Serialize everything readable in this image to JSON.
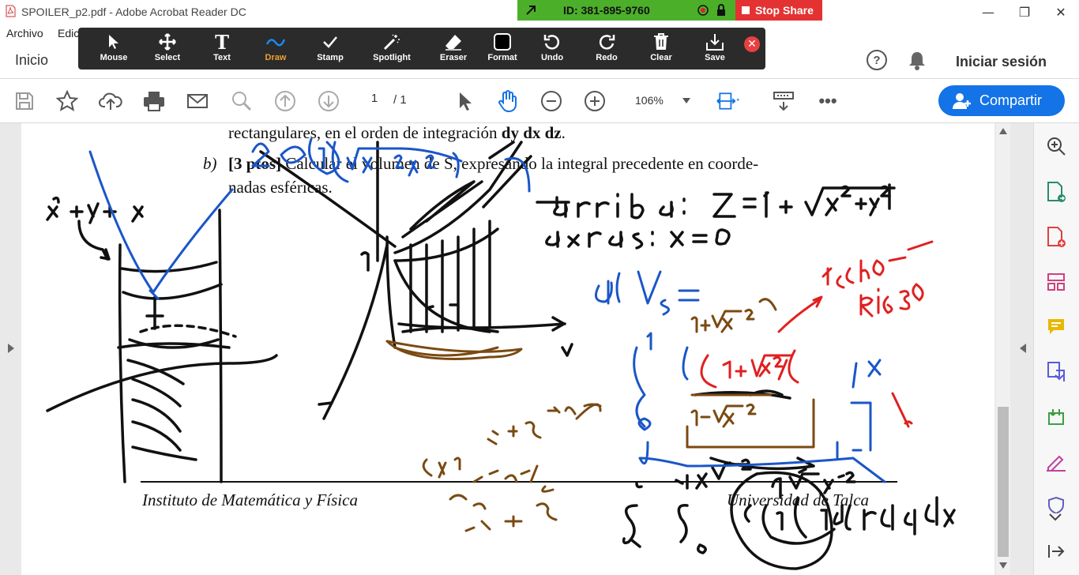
{
  "window": {
    "title": "SPOILER_p2.pdf - Adobe Acrobat Reader DC",
    "controls": {
      "minimize": "—",
      "maximize": "❐",
      "close": "✕"
    }
  },
  "menubar": {
    "items": [
      "Archivo",
      "Edic"
    ]
  },
  "navbar": {
    "home": "Inicio",
    "help": "?",
    "signin": "Iniciar sesión"
  },
  "session": {
    "id_text": "ID: 381-895-9760",
    "stop_label": "Stop Share"
  },
  "annotation_toolbar": {
    "tools": [
      {
        "label": "Mouse",
        "icon": "cursor-icon"
      },
      {
        "label": "Select",
        "icon": "move-icon"
      },
      {
        "label": "Text",
        "icon": "text-icon"
      },
      {
        "label": "Draw",
        "icon": "draw-icon",
        "active": true
      },
      {
        "label": "Stamp",
        "icon": "check-icon"
      },
      {
        "label": "Spotlight",
        "icon": "wand-icon"
      },
      {
        "label": "Eraser",
        "icon": "eraser-icon"
      },
      {
        "label": "Format",
        "icon": "format-icon"
      },
      {
        "label": "Undo",
        "icon": "undo-icon"
      },
      {
        "label": "Redo",
        "icon": "redo-icon"
      },
      {
        "label": "Clear",
        "icon": "trash-icon"
      },
      {
        "label": "Save",
        "icon": "save-icon"
      }
    ],
    "close": "✕"
  },
  "toolbar": {
    "page_current": "1",
    "page_total": "/ 1",
    "zoom": "106%",
    "share_label": "Compartir"
  },
  "document": {
    "line1_prefix": "rectangulares, en el orden de integración ",
    "line1_bold": "dy dx dz",
    "line1_suffix": ".",
    "item_b_label": "b)",
    "item_b_points": "[3 ptos]",
    "item_b_text": " Calcular el volumen de S, expresando la integral precedente en coorde-",
    "item_b_text2": "nadas esféricas.",
    "footer_left": "Instituto de Matemática y Física",
    "footer_right": "Universidad de Talca"
  },
  "colors": {
    "ink_black": "#111111",
    "ink_blue": "#1a56c8",
    "ink_brown": "#7a4a12",
    "ink_red": "#e02020",
    "accent": "#1473e6",
    "session_green": "#4caf2a",
    "stop_red": "#e43232"
  }
}
